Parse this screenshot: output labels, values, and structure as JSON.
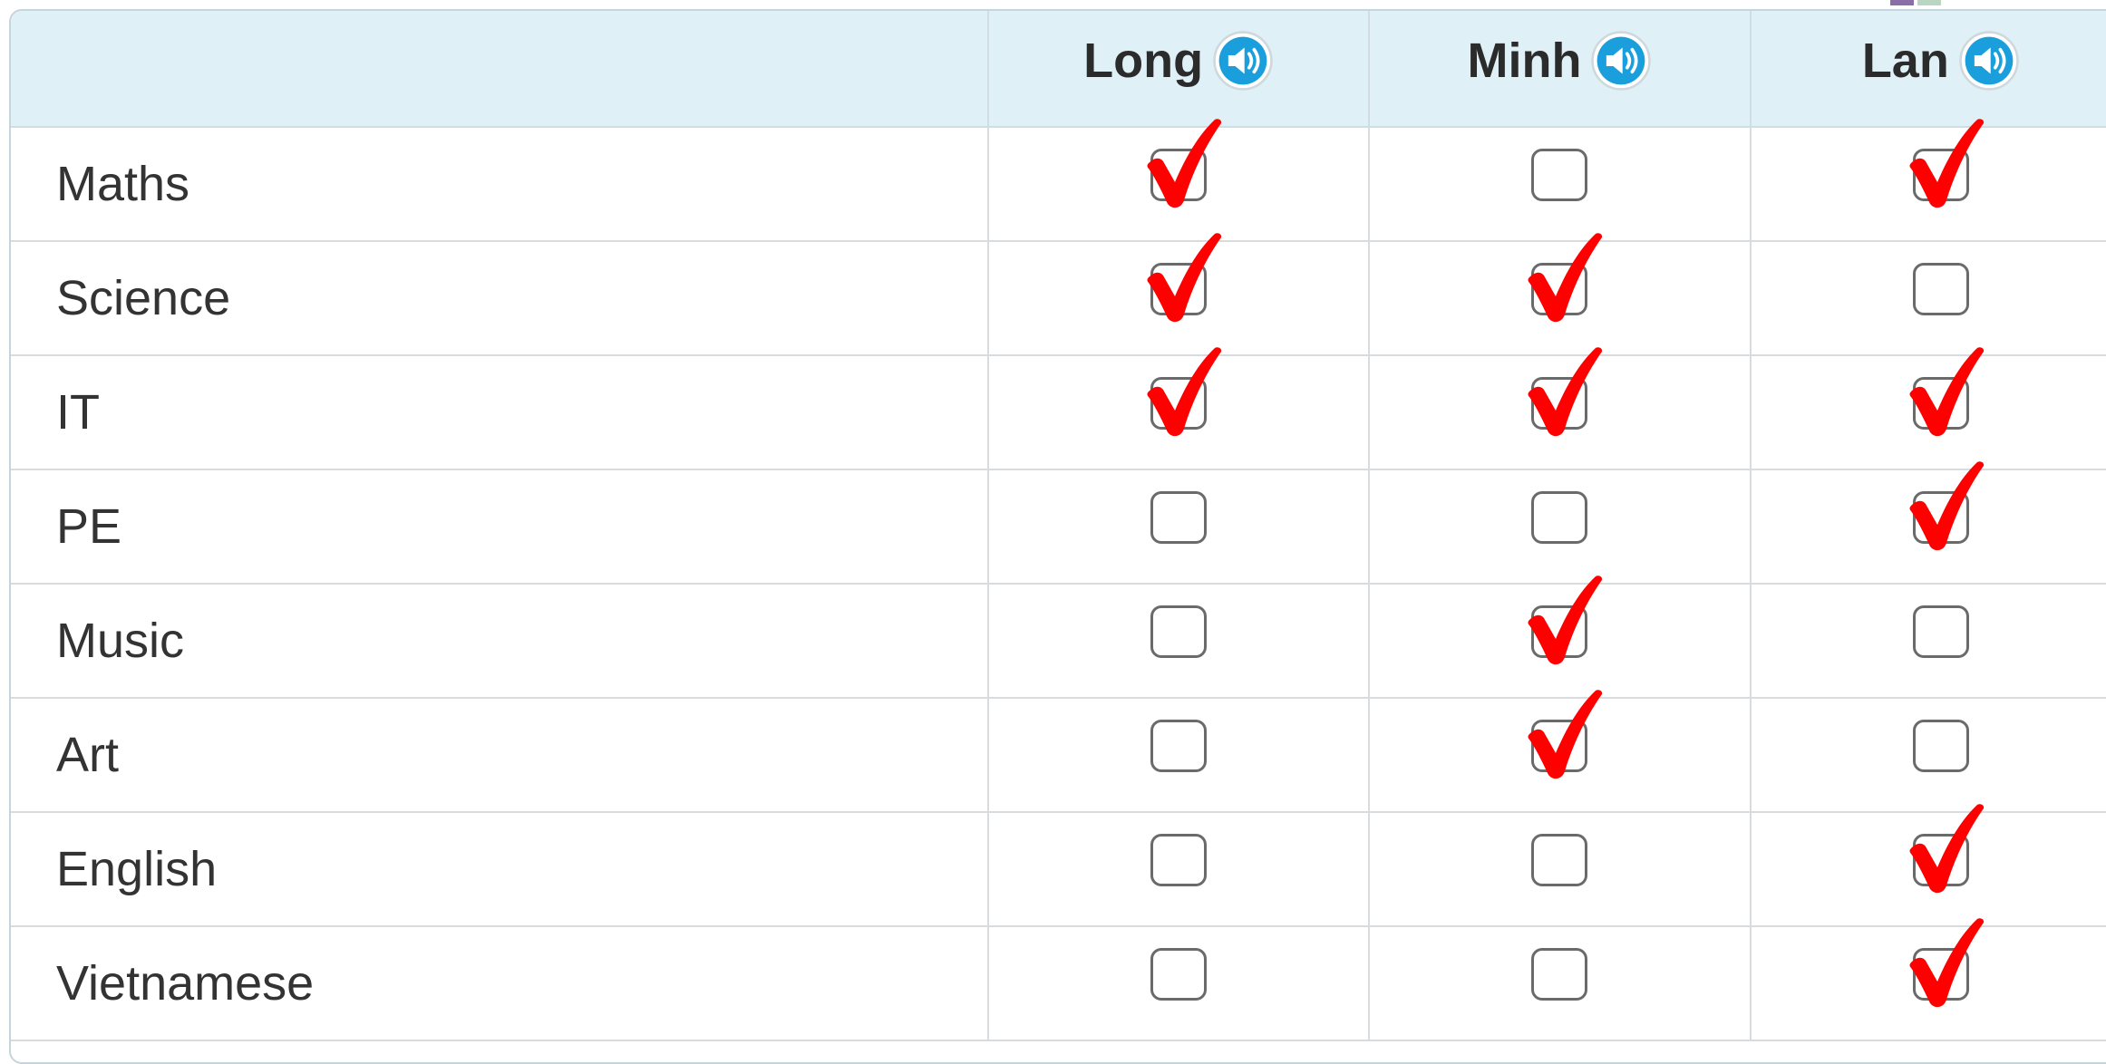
{
  "table": {
    "columns": [
      "Long",
      "Minh",
      "Lan"
    ],
    "rows": [
      {
        "subject": "Maths",
        "checks": [
          true,
          false,
          true
        ]
      },
      {
        "subject": "Science",
        "checks": [
          true,
          true,
          false
        ]
      },
      {
        "subject": "IT",
        "checks": [
          true,
          true,
          true
        ]
      },
      {
        "subject": "PE",
        "checks": [
          false,
          false,
          true
        ]
      },
      {
        "subject": "Music",
        "checks": [
          false,
          true,
          false
        ]
      },
      {
        "subject": "Art",
        "checks": [
          false,
          true,
          false
        ]
      },
      {
        "subject": "English",
        "checks": [
          false,
          false,
          true
        ]
      },
      {
        "subject": "Vietnamese",
        "checks": [
          false,
          false,
          true
        ]
      }
    ]
  },
  "icons": {
    "speaker": "speaker-icon",
    "check": "check-mark-icon"
  },
  "colors": {
    "header_bg": "#dff0f6",
    "speaker_blue": "#1a9fdc",
    "check_red": "#ff0000",
    "checkbox_border": "#6a6a6a"
  }
}
